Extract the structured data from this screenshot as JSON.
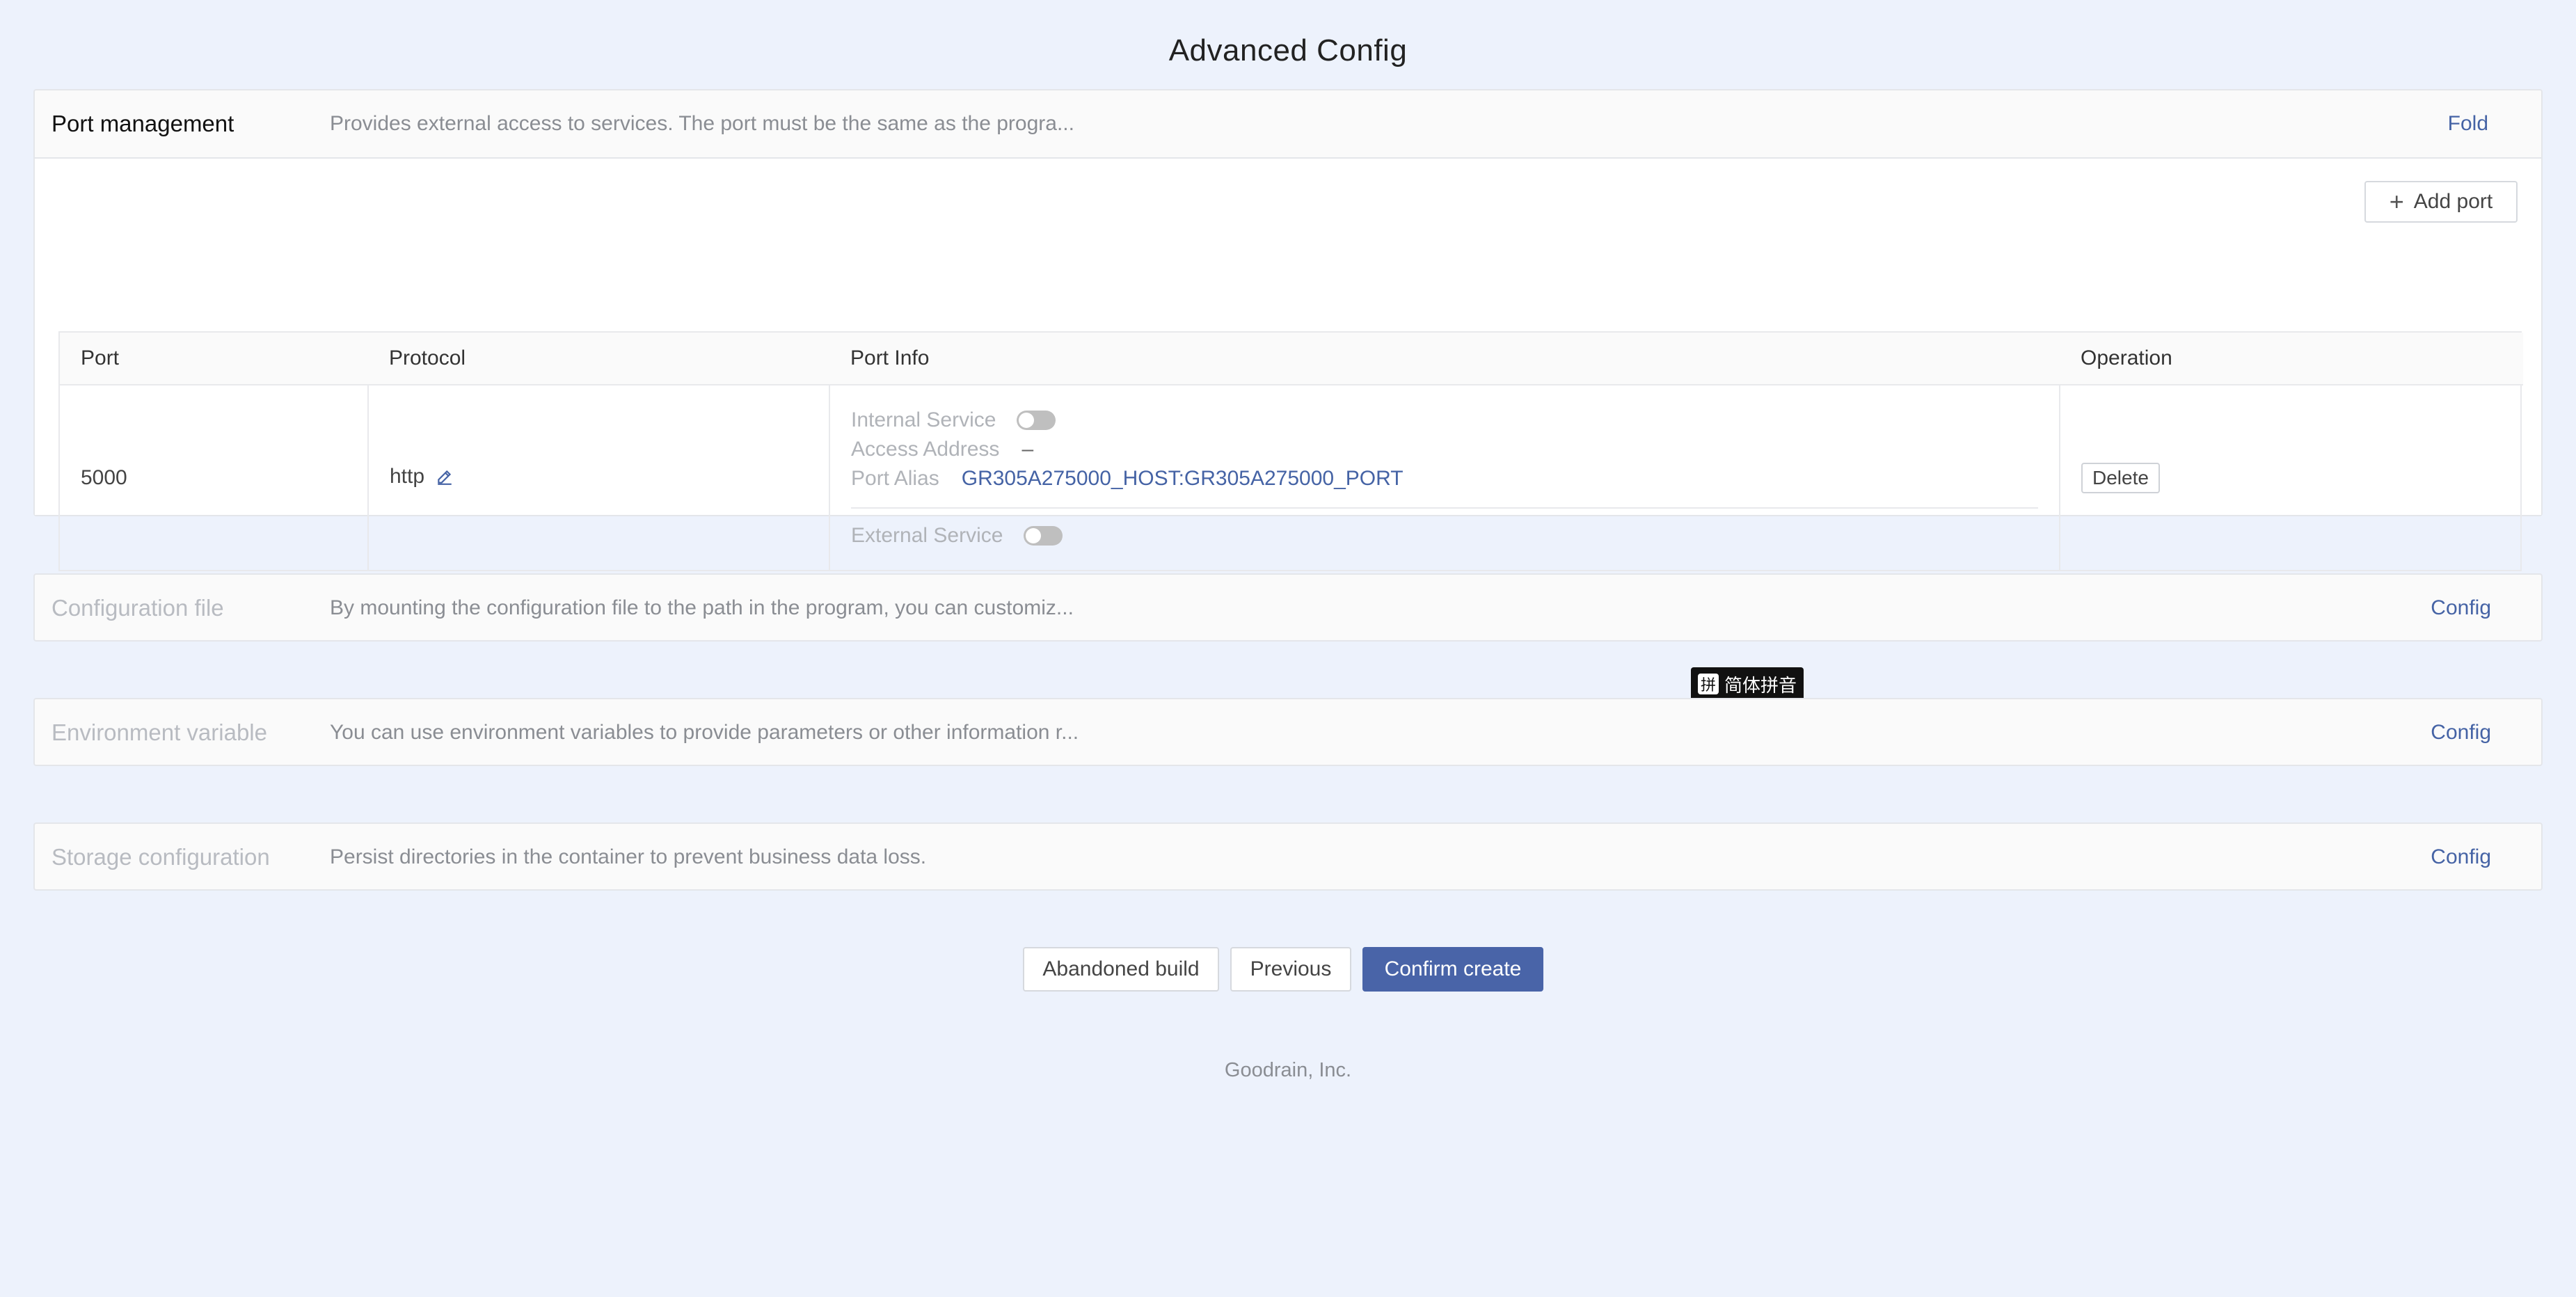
{
  "page": {
    "title": "Advanced Config"
  },
  "port_management": {
    "title": "Port management",
    "description": "Provides external access to services. The port must be the same as the progra...",
    "fold_label": "Fold",
    "add_port_label": "Add port",
    "columns": [
      "Port",
      "Protocol",
      "Port Info",
      "Operation"
    ],
    "rows": [
      {
        "port": "5000",
        "protocol": "http",
        "internal_service_label": "Internal Service",
        "internal_service_enabled": false,
        "access_address_label": "Access Address",
        "access_address_value": "–",
        "port_alias_label": "Port Alias",
        "port_alias_value": "GR305A275000_HOST:GR305A275000_PORT",
        "external_service_label": "External Service",
        "external_service_enabled": false,
        "delete_label": "Delete"
      }
    ]
  },
  "configuration_file": {
    "title": "Configuration file",
    "description": "By mounting the configuration file to the path in the program, you can customiz...",
    "action_label": "Config"
  },
  "environment_variable": {
    "title": "Environment variable",
    "description": "You can use environment variables to provide parameters or other information r...",
    "action_label": "Config"
  },
  "storage_configuration": {
    "title": "Storage configuration",
    "description": "Persist directories in the container to prevent business data loss.",
    "action_label": "Config"
  },
  "ime_indicator": {
    "icon_glyph": "拼",
    "label": "简体拼音"
  },
  "actions": {
    "abandon_label": "Abandoned build",
    "previous_label": "Previous",
    "confirm_label": "Confirm create"
  },
  "footer": {
    "text": "Goodrain, Inc."
  },
  "colors": {
    "background": "#edf2fc",
    "primary": "#4964a8",
    "link": "#4563a5"
  }
}
